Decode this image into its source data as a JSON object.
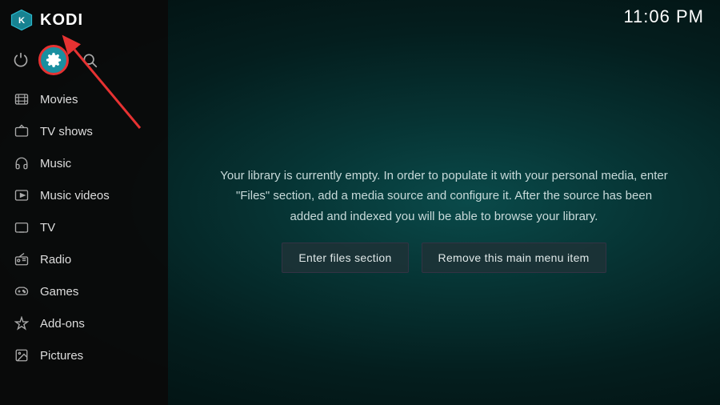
{
  "app": {
    "title": "KODI"
  },
  "clock": {
    "time": "11:06 PM"
  },
  "sidebar": {
    "nav_items": [
      {
        "id": "movies",
        "label": "Movies",
        "icon": "🎬"
      },
      {
        "id": "tvshows",
        "label": "TV shows",
        "icon": "🖥"
      },
      {
        "id": "music",
        "label": "Music",
        "icon": "🎧"
      },
      {
        "id": "musicvideos",
        "label": "Music videos",
        "icon": "🎞"
      },
      {
        "id": "tv",
        "label": "TV",
        "icon": "📺"
      },
      {
        "id": "radio",
        "label": "Radio",
        "icon": "📻"
      },
      {
        "id": "games",
        "label": "Games",
        "icon": "🎮"
      },
      {
        "id": "addons",
        "label": "Add-ons",
        "icon": "📦"
      },
      {
        "id": "pictures",
        "label": "Pictures",
        "icon": "🖼"
      }
    ]
  },
  "main": {
    "library_message": "Your library is currently empty. In order to populate it with your personal media, enter \"Files\" section, add a media source and configure it. After the source has been added and indexed you will be able to browse your library.",
    "btn_enter_files": "Enter files section",
    "btn_remove": "Remove this main menu item"
  }
}
